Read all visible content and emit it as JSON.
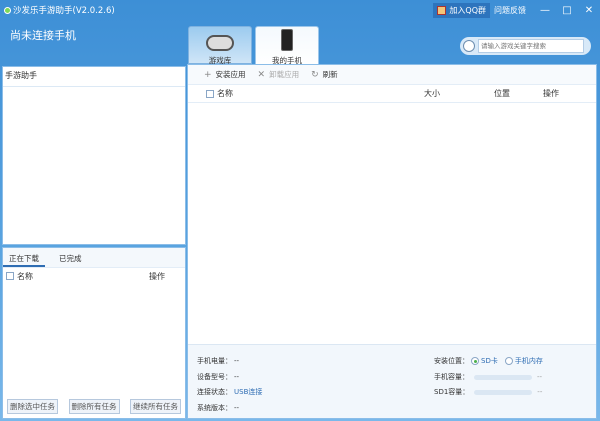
{
  "window": {
    "title": "沙发乐手游助手(V2.0.2.6)",
    "qq_group": "加入QQ群",
    "feedback": "问题反馈",
    "minimize": "—",
    "maximize": "□",
    "close": "✕"
  },
  "status": "尚未连接手机",
  "sidebar": {
    "header": "手游助手"
  },
  "downloads": {
    "tabs": [
      "正在下载",
      "已完成"
    ],
    "col_name": "名称",
    "col_action": "操作",
    "buttons": [
      "删除选中任务",
      "删除所有任务",
      "继续所有任务"
    ]
  },
  "tabs": [
    {
      "label": "游戏库",
      "icon": "gamepad-icon"
    },
    {
      "label": "我的手机",
      "icon": "phone-icon",
      "active": true
    }
  ],
  "search": {
    "placeholder": "请输入游戏关键字搜索"
  },
  "toolbar": {
    "install": "安装应用",
    "uninstall": "卸载应用",
    "refresh": "刷新"
  },
  "list": {
    "columns": [
      "名称",
      "大小",
      "位置",
      "操作"
    ]
  },
  "info": {
    "battery_label": "手机电量：",
    "battery": "--",
    "model_label": "设备型号：",
    "model": "--",
    "conn_label": "连接状态：",
    "conn": "USB连接",
    "os_label": "系统版本：",
    "os": "--",
    "install_label": "安装位置：",
    "opt_sd": "SD卡",
    "opt_phone": "手机内存",
    "selected": "SD卡",
    "phone_cap_label": "手机容量：",
    "phone_cap": "--",
    "sd_cap_label": "SD1容量：",
    "sd_cap": "--"
  }
}
